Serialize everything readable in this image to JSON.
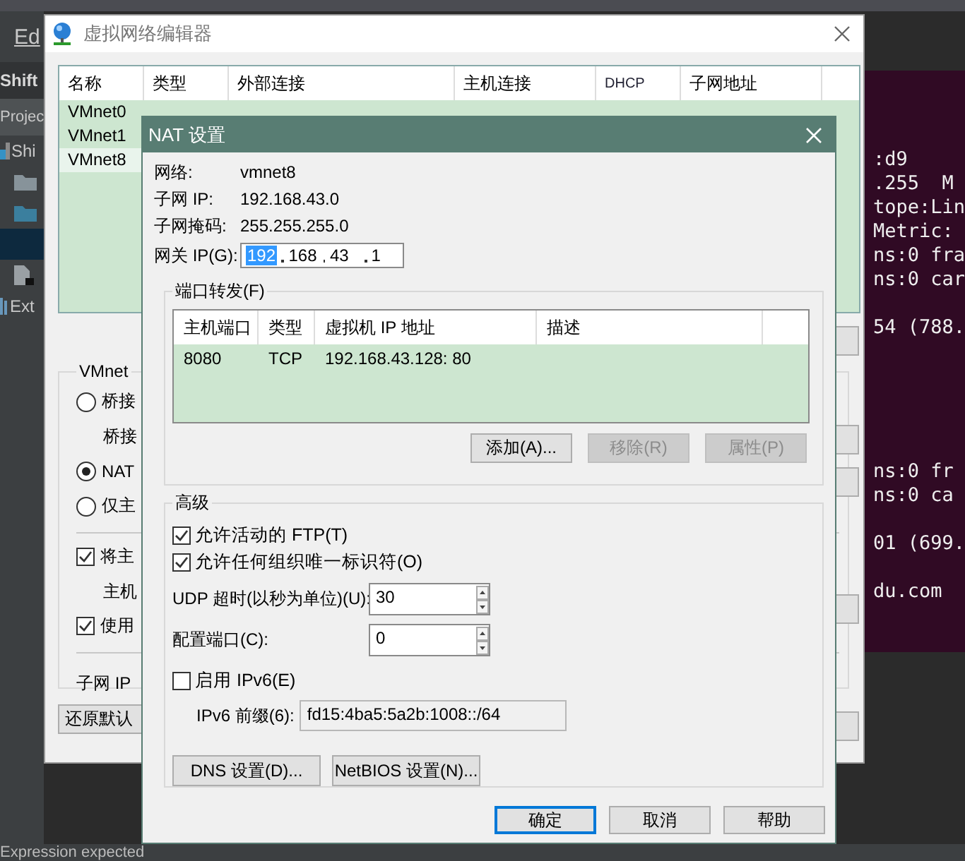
{
  "ide": {
    "menu_item": "Ed",
    "project_title": "Shift",
    "panel_tab": "Projec",
    "tree": [
      {
        "kind": "project",
        "label": "Shi",
        "selected": false
      },
      {
        "kind": "folder",
        "selected": false
      },
      {
        "kind": "folder",
        "selected": false
      },
      {
        "kind": "blank",
        "selected": true
      },
      {
        "kind": "file",
        "selected": false
      },
      {
        "kind": "library",
        "label": "Ext",
        "selected": false
      }
    ],
    "status": "Expression expected"
  },
  "terminal": {
    "blocks": [
      [
        ":d9",
        ".255  M",
        "tope:Lin",
        "Metric:",
        "ns:0 fra",
        "ns:0 car"
      ],
      [
        "54 (788."
      ],
      [
        "ns:0 fr",
        "ns:0 ca"
      ],
      [
        "01 (699."
      ],
      [
        "du.com"
      ]
    ]
  },
  "editor_window": {
    "title": "虚拟网络编辑器",
    "table": {
      "columns": [
        "名称",
        "类型",
        "外部连接",
        "主机连接",
        "DHCP",
        "子网地址"
      ],
      "rows": [
        {
          "cells": [
            "VMnet0"
          ],
          "selected": false
        },
        {
          "cells": [
            "VMnet1"
          ],
          "selected": false
        },
        {
          "cells": [
            "VMnet8"
          ],
          "selected": true
        }
      ]
    },
    "info_group": {
      "title": "VMnet",
      "items": [
        {
          "kind": "radio",
          "label": "桥接",
          "selected": false
        },
        {
          "kind": "text",
          "label": "桥接"
        },
        {
          "kind": "radio",
          "label": "NAT",
          "selected": true
        },
        {
          "kind": "radio",
          "label": "仅主",
          "selected": false
        },
        {
          "kind": "divider"
        },
        {
          "kind": "checkbox",
          "label": "将主",
          "checked": true
        },
        {
          "kind": "text",
          "label": "主机"
        },
        {
          "kind": "checkbox",
          "label": "使用",
          "checked": true
        },
        {
          "kind": "divider"
        },
        {
          "kind": "text",
          "label": "子网 IP"
        }
      ]
    },
    "restore_button": "还原默认"
  },
  "nat_dialog": {
    "title": "NAT 设置",
    "info": [
      {
        "label": "网络:",
        "value": "vmnet8"
      },
      {
        "label": "子网 IP:",
        "value": "192.168.43.0"
      },
      {
        "label": "子网掩码:",
        "value": "255.255.255.0"
      }
    ],
    "gateway": {
      "label": "网关 IP(G):",
      "octets": [
        {
          "value": "192",
          "selected": true
        },
        {
          "value": "168",
          "selected": false
        },
        {
          "value": "43",
          "selected": false
        },
        {
          "value": "1",
          "selected": false
        }
      ]
    },
    "port_forwarding": {
      "title": "端口转发(F)",
      "columns": [
        "主机端口",
        "类型",
        "虚拟机 IP 地址",
        "描述"
      ],
      "rows": [
        [
          "8080",
          "TCP",
          "192.168.43.128: 80"
        ]
      ],
      "buttons": [
        {
          "label": "添加(A)...",
          "disabled": false
        },
        {
          "label": "移除(R)",
          "disabled": true
        },
        {
          "label": "属性(P)",
          "disabled": true
        }
      ]
    },
    "advanced": {
      "title": "高级",
      "checkboxes": [
        {
          "label": "允许活动的 FTP(T)",
          "checked": true
        },
        {
          "label": "允许任何组织唯一标识符(O)",
          "checked": true
        }
      ],
      "spinners": [
        {
          "label": "UDP 超时(以秒为单位)(U):",
          "value": "30"
        },
        {
          "label": "配置端口(C):",
          "value": "0"
        }
      ],
      "ipv6": {
        "label": "启用 IPv6(E)",
        "checked": false
      },
      "prefix": {
        "label": "IPv6 前缀(6):",
        "value": "fd15:4ba5:5a2b:1008::/64",
        "disabled": true
      },
      "buttons": [
        "DNS 设置(D)...",
        "NetBIOS 设置(N)..."
      ]
    },
    "buttons": [
      {
        "label": "确定",
        "default": true
      },
      {
        "label": "取消",
        "default": false
      },
      {
        "label": "帮助",
        "default": false
      }
    ]
  }
}
